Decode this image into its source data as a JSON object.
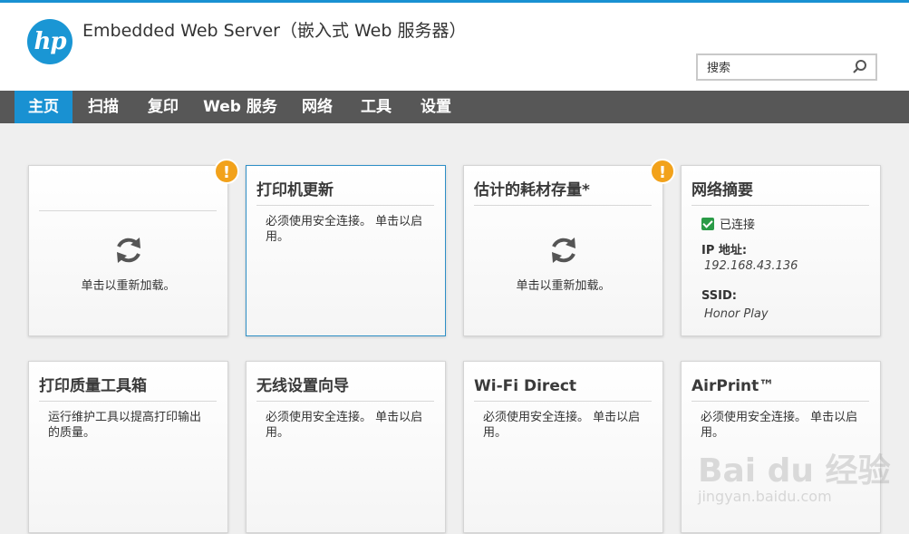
{
  "header": {
    "logo": "hp",
    "title": "Embedded Web Server（嵌入式 Web 服务器）"
  },
  "search": {
    "placeholder": "搜索"
  },
  "nav": [
    {
      "label": "主页",
      "active": true
    },
    {
      "label": "扫描"
    },
    {
      "label": "复印"
    },
    {
      "label": "Web 服务"
    },
    {
      "label": "网络"
    },
    {
      "label": "工具"
    },
    {
      "label": "设置"
    }
  ],
  "cards": {
    "status": {
      "title": "",
      "reload": "单击以重新加载。",
      "alert": "!"
    },
    "printer_update": {
      "title": "打印机更新",
      "body": "必须使用安全连接。 单击以启用。"
    },
    "supplies": {
      "title": "估计的耗材存量*",
      "reload": "单击以重新加载。",
      "alert": "!"
    },
    "network_summary": {
      "title": "网络摘要",
      "connected": "已连接",
      "ip_label": "IP 地址:",
      "ip_value": "192.168.43.136",
      "ssid_label": "SSID:",
      "ssid_value": "Honor Play"
    },
    "print_quality": {
      "title": "打印质量工具箱",
      "body": "运行维护工具以提高打印输出的质量。"
    },
    "wireless_wizard": {
      "title": "无线设置向导",
      "body": "必须使用安全连接。 单击以启用。"
    },
    "wifi_direct": {
      "title": "Wi-Fi Direct",
      "body": "必须使用安全连接。 单击以启用。"
    },
    "airprint": {
      "title": "AirPrint™",
      "body": "必须使用安全连接。 单击以启用。"
    }
  },
  "watermark": {
    "logo": "Bai du 经验",
    "url": "jingyan.baidu.com"
  },
  "colors": {
    "accent": "#1991d2",
    "nav_bg": "#575757",
    "alert": "#f2a21b",
    "check": "#2a9b47"
  }
}
